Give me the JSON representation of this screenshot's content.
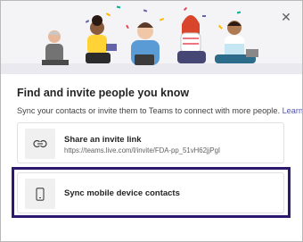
{
  "dialog": {
    "title": "Find and invite people you know",
    "subtitle": "Sync your contacts or invite them to Teams to connect with more people.",
    "learn_more": "Learn more",
    "close_glyph": "✕"
  },
  "options": [
    {
      "title": "Share an invite link",
      "subtitle": "https://teams.live.com/l/invite/FDA-pp_51vH62jjPgI",
      "icon": "link-icon"
    },
    {
      "title": "Sync mobile device contacts",
      "icon": "phone-icon"
    }
  ],
  "colors": {
    "accent": "#4f52b2",
    "highlight_border": "#2d1a6e"
  }
}
